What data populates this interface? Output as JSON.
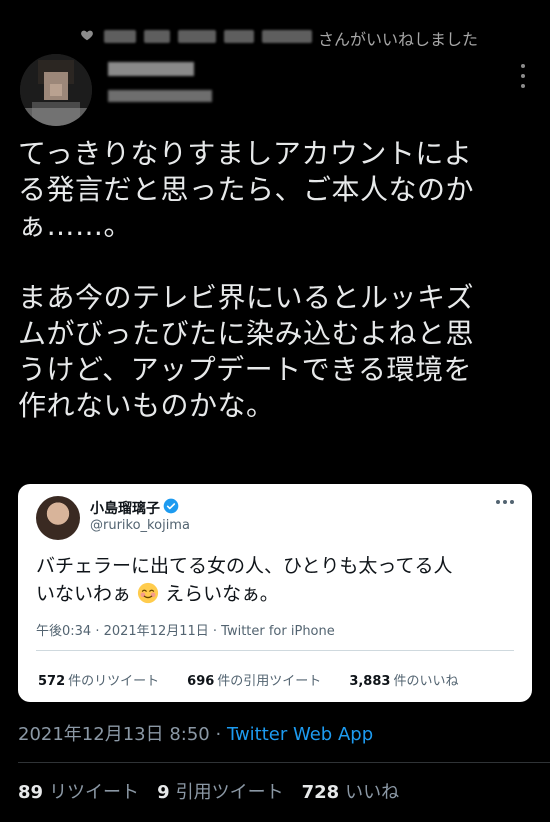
{
  "social_context": {
    "suffix": "さんがいいねしました"
  },
  "tweet": {
    "paragraphs": [
      [
        "てっきりなりすましアカウントによ",
        "る発言だと思ったら、ご本人なのか",
        "ぁ……。"
      ],
      [
        "まあ今のテレビ界にいるとルッキズ",
        "ムがびったびたに染み込むよねと思",
        "うけど、アップデートできる環境を",
        "作れないものかな。"
      ]
    ],
    "timestamp": "2021年12月13日 8:50",
    "separator": " · ",
    "app": "Twitter Web App",
    "stats": {
      "retweets_count": "89",
      "retweets_label": "リツイート",
      "quotes_count": "9",
      "quotes_label": "引用ツイート",
      "likes_count": "728",
      "likes_label": "いいね"
    }
  },
  "quoted": {
    "name": "小島瑠璃子",
    "handle": "@ruriko_kojima",
    "line1": "バチェラーに出てる女の人、ひとりも太ってる人",
    "line2_before": "いないわぁ",
    "line2_after": "えらいなぁ。",
    "meta": "午後0:34 · 2021年12月11日 · Twitter for iPhone",
    "stats": {
      "retweets_count": "572",
      "retweets_label": "件のリツイート",
      "quotes_count": "696",
      "quotes_label": "件の引用ツイート",
      "likes_count": "3,883",
      "likes_label": "件のいいね"
    }
  },
  "icons": [
    "heart-icon",
    "more-icon",
    "verified-icon",
    "smiling-face-emoji"
  ],
  "colors": {
    "background": "#000000",
    "link": "#1d9bf0",
    "verified": "#1d9bf0",
    "muted": "#8b98a5"
  }
}
